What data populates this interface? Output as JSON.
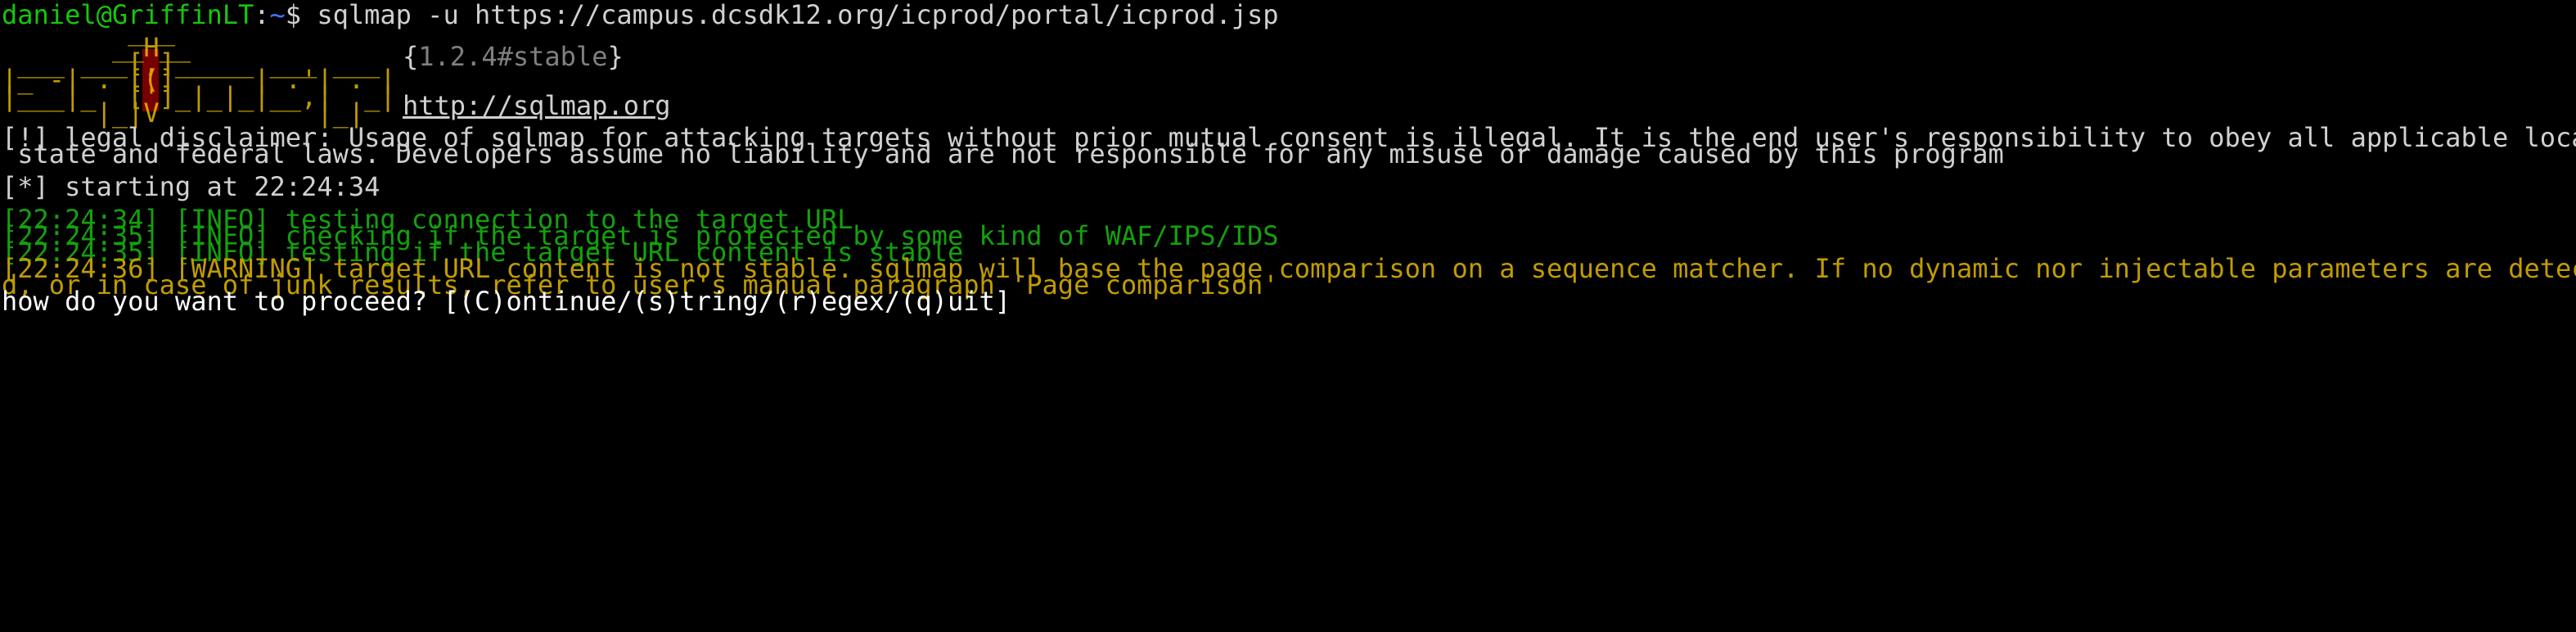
{
  "prompt": {
    "user_host": "daniel@GriffinLT",
    "separator": ":",
    "path": "~",
    "dollar": "$",
    "command": "sqlmap -u https://campus.dcsdk12.org/icprod/portal/icprod.jsp"
  },
  "banner": {
    "logo_lines": [
      "        ___",
      "       __H__",
      " ___ ___[,]_____ ___ ___  ",
      "|_ -| . [(]     | .'| . | ",
      "|___|_  [']_|_|_|__,|  _| ",
      "      |_|V          |_|   "
    ],
    "version_open": "{",
    "version": "1.2.4#stable",
    "version_close": "}",
    "url": "http://sqlmap.org"
  },
  "disclaimer": {
    "line1": "[!] legal disclaimer: Usage of sqlmap for attacking targets without prior mutual consent is illegal. It is the end user's responsibility to obey all applicable local,",
    "line2": " state and federal laws. Developers assume no liability and are not responsible for any misuse or damage caused by this program"
  },
  "starting": "[*] starting at 22:24:34",
  "log": [
    {
      "level": "info",
      "text": "[22:24:34] [INFO] testing connection to the target URL"
    },
    {
      "level": "info",
      "text": "[22:24:35] [INFO] checking if the target is protected by some kind of WAF/IPS/IDS"
    },
    {
      "level": "info",
      "text": "[22:24:35] [INFO] testing if the target URL content is stable"
    },
    {
      "level": "warn",
      "text": "[22:24:36] [WARNING] target URL content is not stable. sqlmap will base the page comparison on a sequence matcher. If no dynamic nor injectable parameters are detecte"
    },
    {
      "level": "warn",
      "text": "d, or in case of junk results, refer to user's manual paragraph 'Page comparison'"
    }
  ],
  "question": "how do you want to proceed? [(C)ontinue/(s)tring/(r)egex/(q)uit]",
  "colors": {
    "background": "#000000",
    "foreground": "#d0d0d0",
    "prompt_user": "#16c60c",
    "prompt_path": "#3b78ff",
    "logo": "#c19c00",
    "logo_highlight_bg": "#8b0000",
    "info": "#13a10e",
    "warning": "#c19c00",
    "version": "#808080"
  }
}
